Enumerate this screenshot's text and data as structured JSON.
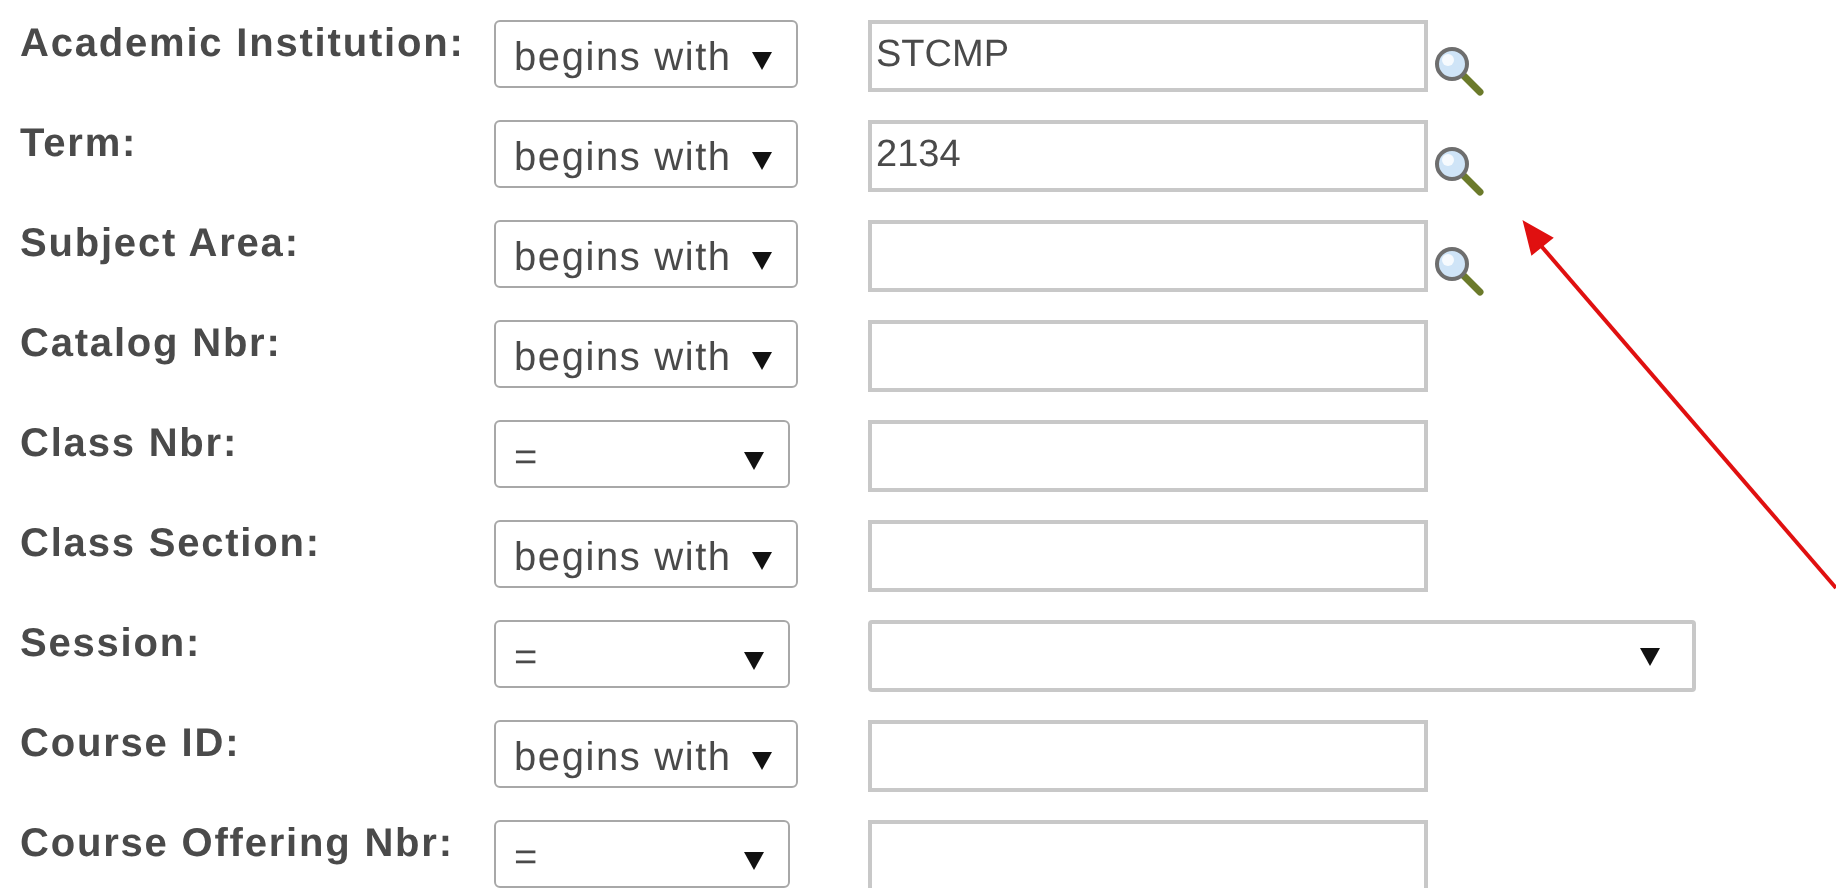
{
  "criteria": [
    {
      "label": "Academic Institution:",
      "operator": "begins with",
      "field": {
        "kind": "text",
        "value": "STCMP"
      },
      "lookup": true
    },
    {
      "label": "Term:",
      "operator": "begins with",
      "field": {
        "kind": "text",
        "value": "2134"
      },
      "lookup": true
    },
    {
      "label": "Subject Area:",
      "operator": "begins with",
      "field": {
        "kind": "text"
      },
      "lookup": true
    },
    {
      "label": "Catalog Nbr:",
      "operator": "begins with",
      "field": {
        "kind": "text"
      },
      "lookup": false
    },
    {
      "label": "Class Nbr:",
      "operator": "=",
      "field": {
        "kind": "text"
      },
      "lookup": false
    },
    {
      "label": "Class Section:",
      "operator": "begins with",
      "field": {
        "kind": "text"
      },
      "lookup": false
    },
    {
      "label": "Session:",
      "operator": "=",
      "field": {
        "kind": "dropdown"
      },
      "lookup": false
    },
    {
      "label": "Course ID:",
      "operator": "begins with",
      "field": {
        "kind": "text"
      },
      "lookup": false
    },
    {
      "label": "Course Offering Nbr:",
      "operator": "=",
      "field": {
        "kind": "text"
      },
      "lookup": false
    }
  ],
  "annotation": {
    "kind": "arrow"
  }
}
